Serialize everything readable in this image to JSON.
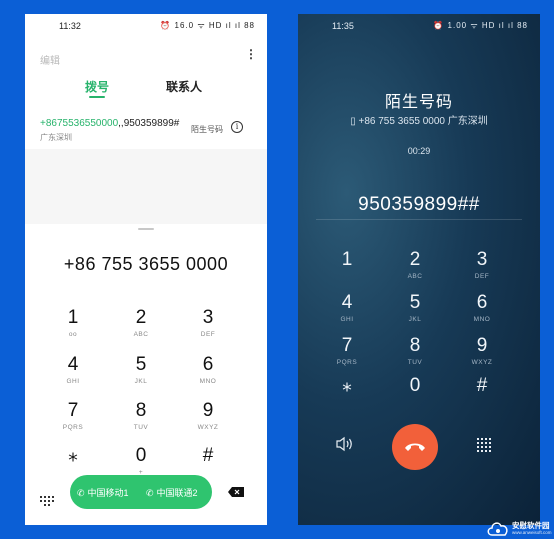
{
  "colors": {
    "background": "#0b5fd6",
    "accent_green": "#27b36b",
    "call_button": "#2fc46f",
    "end_call": "#f2603a"
  },
  "left_phone": {
    "status_bar": {
      "time": "11:32",
      "icons": "⏰ 16.0 ᯤ HD ıl ıl 88"
    },
    "edit_label": "编辑",
    "more_icon": "more-vertical-icon",
    "tabs": {
      "dial": "拨号",
      "contacts": "联系人"
    },
    "recent": {
      "number_highlight": "+8675536550000",
      "number_rest": ",,950359899#",
      "location": "广东深圳",
      "tag": "陌生号码",
      "info_icon": "i"
    },
    "entered_number": "+86 755 3655 0000",
    "keys": [
      {
        "digit": "1",
        "letters": "ᴏᴏ"
      },
      {
        "digit": "2",
        "letters": "ABC"
      },
      {
        "digit": "3",
        "letters": "DEF"
      },
      {
        "digit": "4",
        "letters": "GHI"
      },
      {
        "digit": "5",
        "letters": "JKL"
      },
      {
        "digit": "6",
        "letters": "MNO"
      },
      {
        "digit": "7",
        "letters": "PQRS"
      },
      {
        "digit": "8",
        "letters": "TUV"
      },
      {
        "digit": "9",
        "letters": "WXYZ"
      },
      {
        "digit": "⁎",
        "letters": ""
      },
      {
        "digit": "0",
        "letters": "+"
      },
      {
        "digit": "#",
        "letters": ""
      }
    ],
    "call_sim1": "中国移动1",
    "call_sim2": "中国联通2"
  },
  "right_phone": {
    "status_bar": {
      "time": "11:35",
      "icons": "⏰ 1.00 ᯤ HD ıl ıl 88"
    },
    "caller_title": "陌生号码",
    "caller_sub": "+86 755 3655 0000  广东深圳",
    "timer": "00:29",
    "entered_digits": "950359899##",
    "keys": [
      {
        "digit": "1",
        "letters": ""
      },
      {
        "digit": "2",
        "letters": "ABC"
      },
      {
        "digit": "3",
        "letters": "DEF"
      },
      {
        "digit": "4",
        "letters": "GHI"
      },
      {
        "digit": "5",
        "letters": "JKL"
      },
      {
        "digit": "6",
        "letters": "MNO"
      },
      {
        "digit": "7",
        "letters": "PQRS"
      },
      {
        "digit": "8",
        "letters": "TUV"
      },
      {
        "digit": "9",
        "letters": "WXYZ"
      },
      {
        "digit": "⁎",
        "letters": ""
      },
      {
        "digit": "0",
        "letters": ""
      },
      {
        "digit": "#",
        "letters": ""
      }
    ]
  },
  "watermark": {
    "name": "安慰软件园",
    "url": "www.anweisoft.com"
  }
}
